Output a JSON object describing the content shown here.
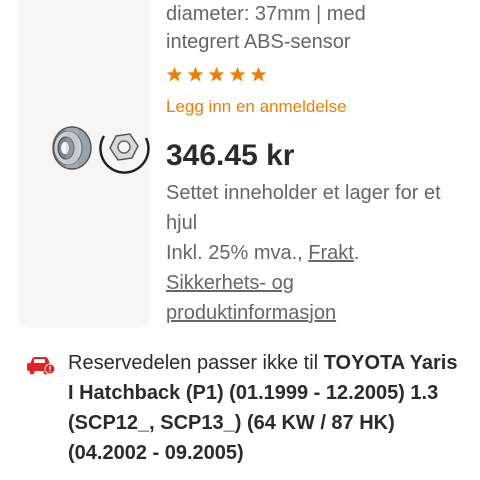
{
  "product": {
    "description_line1": "diameter: 37mm | med",
    "description_line2": "integrert ABS-sensor",
    "rating_stars": 5,
    "review_link": "Legg inn en anmeldelse",
    "price": "346.45 kr",
    "contents_text": "Settet inneholder et lager for et hjul",
    "vat_text": "Inkl. 25% mva., ",
    "shipping_link": "Frakt",
    "vat_suffix": ".",
    "safety_link": "Sikkerhets- og produktinformasjon",
    "star_color": "#f07d00",
    "link_color": "#f07d00"
  },
  "fitment": {
    "prefix": "Reservedelen passer ikke til ",
    "vehicle": "TOYOTA Yaris I Hatchback (P1) (01.1999 - 12.2005) 1.3 (SCP12_, SCP13_) (64 KW / 87 HK) (04.2002 - 09.2005)",
    "icon": "car-warning-icon",
    "icon_color": "#e02424"
  }
}
